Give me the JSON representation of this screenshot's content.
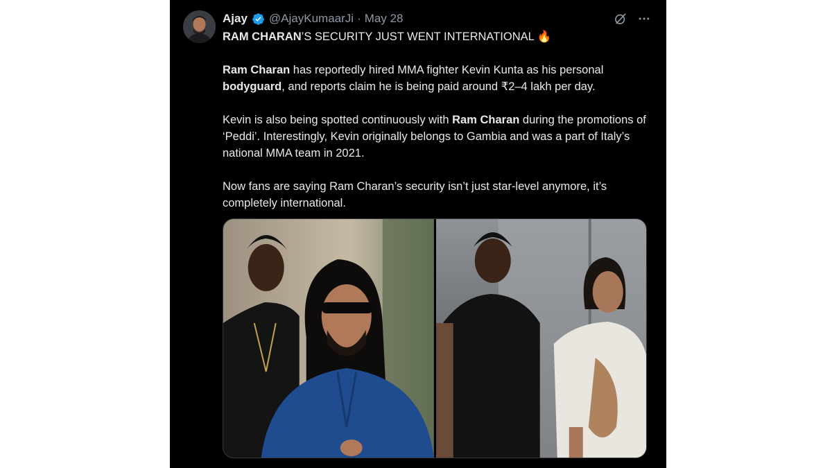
{
  "tweet": {
    "display_name": "Ajay",
    "handle": "@AjayKumaarJi",
    "separator": "·",
    "date": "May 28",
    "icons": {
      "verified": "verified-badge-icon",
      "grok": "grok-icon",
      "more": "more-icon",
      "fire": "fire-emoji-icon"
    },
    "body": {
      "headline_bold": "RAM CHARAN",
      "headline_rest": "’S SECURITY JUST WENT INTERNATIONAL ",
      "fire_emoji": "🔥",
      "p1_bold1": "Ram Charan",
      "p1_text1": " has reportedly hired MMA fighter Kevin Kunta as his personal ",
      "p1_bold2": "bodyguard",
      "p1_text2": ", and reports claim he is being paid around ₹2–4 lakh per day.",
      "p2_text1": "Kevin is also being spotted continuously with ",
      "p2_bold": "Ram Charan",
      "p2_text2": " during the promotions of ‘Peddi’. Interestingly, Kevin originally belongs to Gambia and was a part of Italy’s national MMA team in 2021.",
      "p3": "Now fans are saying Ram Charan’s security isn’t just star-level anymore, it’s completely international."
    },
    "colors": {
      "background": "#000000",
      "text": "#e7e9ea",
      "muted": "#8b98a5",
      "verified": "#1d9bf0"
    }
  }
}
